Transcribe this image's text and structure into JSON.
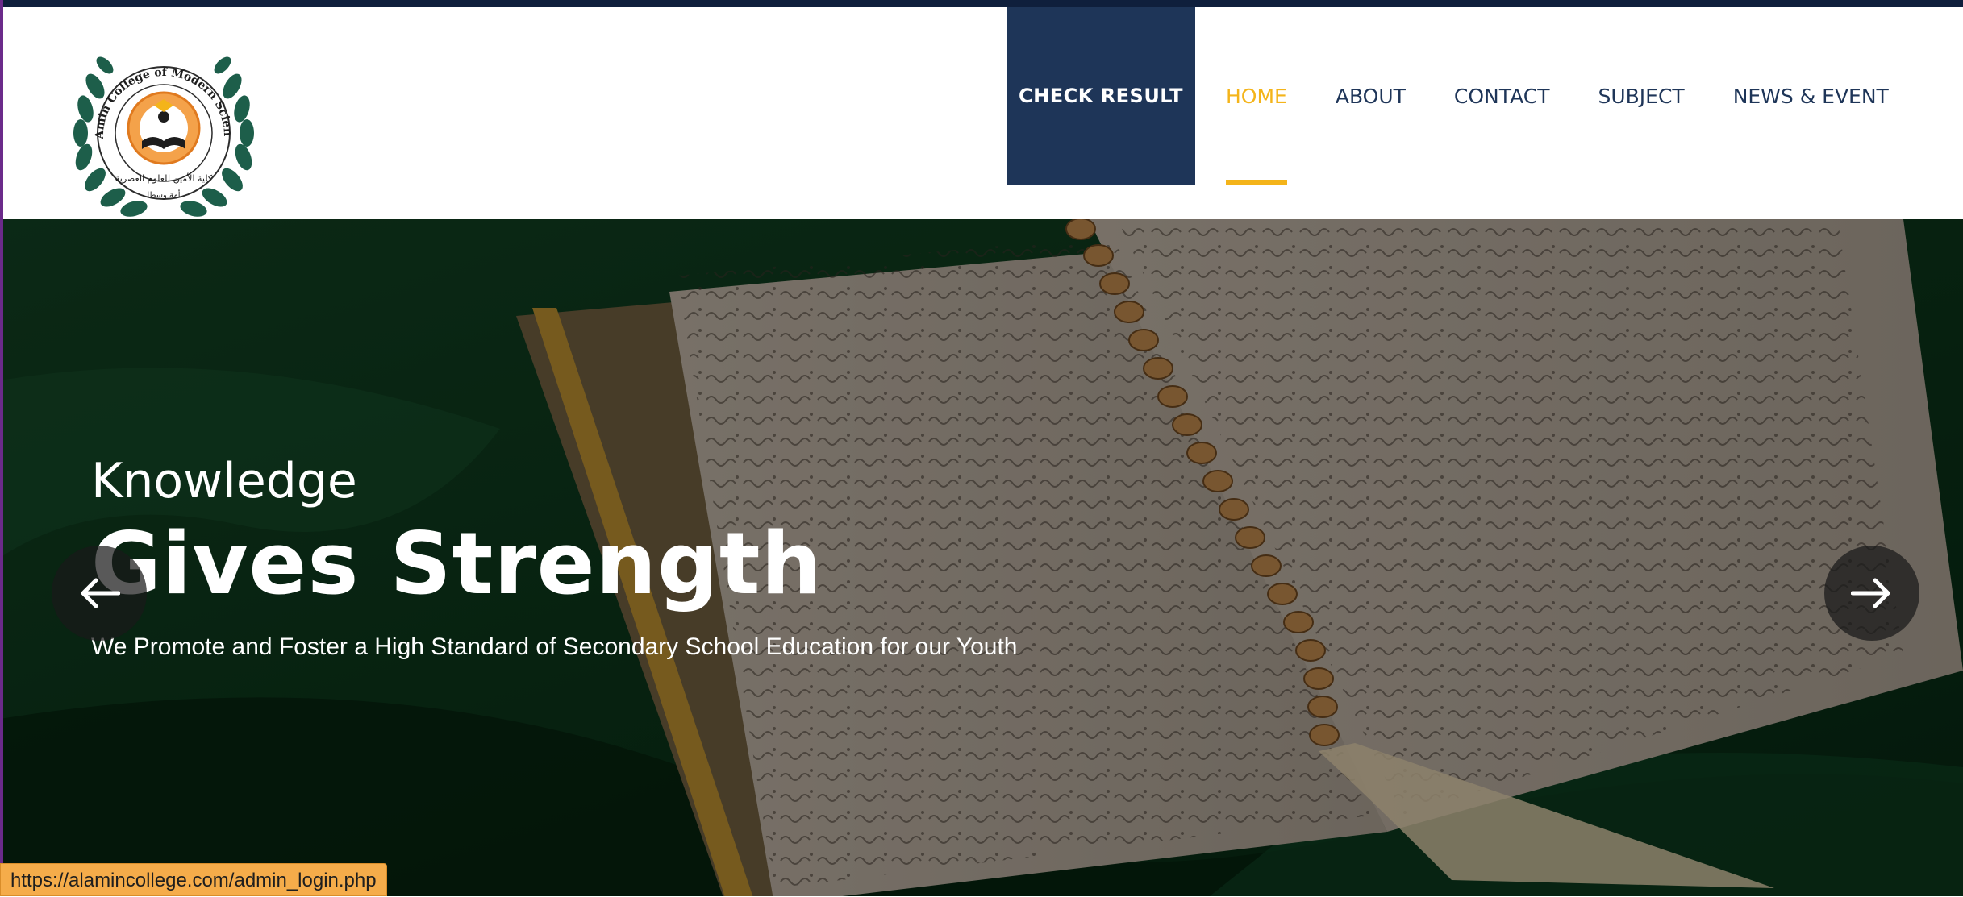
{
  "header": {
    "logo": {
      "ring_text": "El-Amin College of Modern Sciences",
      "arabic_text": "كلية الأمين للعلوم العصرية",
      "motto": "أمة وسطا"
    },
    "check_result_label": "CHECK RESULT",
    "nav": [
      {
        "label": "HOME",
        "active": true
      },
      {
        "label": "ABOUT",
        "active": false
      },
      {
        "label": "CONTACT",
        "active": false
      },
      {
        "label": "SUBJECT",
        "active": false
      },
      {
        "label": "NEWS & EVENT",
        "active": false
      }
    ]
  },
  "hero": {
    "kicker": "Knowledge",
    "title": "Gives Strength",
    "tagline": "We Promote and Foster a High Standard of Secondary School Education for our Youth",
    "prev_icon": "arrow-left-icon",
    "next_icon": "arrow-right-icon"
  },
  "status_bar": {
    "url": "https://alamincollege.com/admin_login.php"
  },
  "colors": {
    "navy": "#1e3558",
    "accent": "#f4b41a",
    "topbar": "#0f1f3c",
    "hero_green": "#0d3a1e"
  }
}
